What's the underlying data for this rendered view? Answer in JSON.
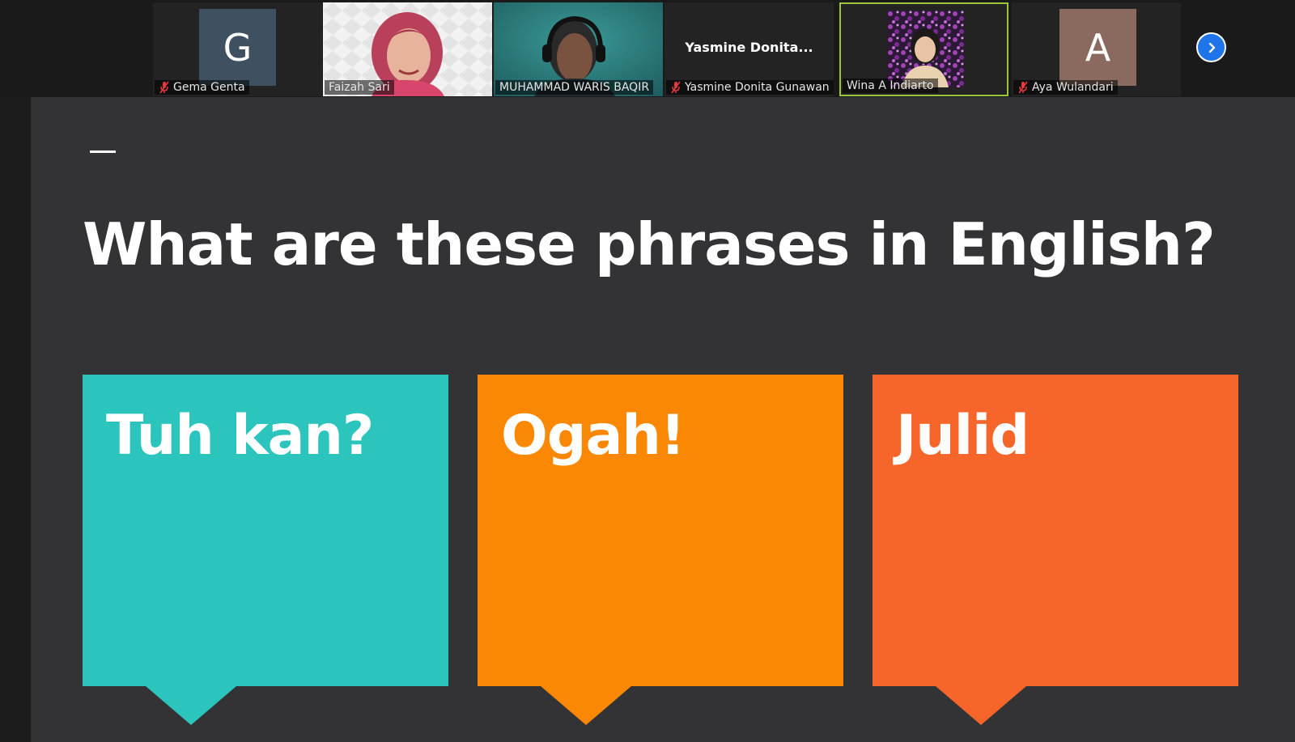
{
  "participants": [
    {
      "name": "Gema Genta",
      "initial": "G",
      "avatar_color": "#3f5160",
      "muted": true,
      "video": false
    },
    {
      "name": "Faizah Sari",
      "muted": false,
      "video": true
    },
    {
      "name": "MUHAMMAD WARIS BAQIR",
      "muted": false,
      "video": true
    },
    {
      "name": "Yasmine Donita Gunawan",
      "short_name": "Yasmine  Donita...",
      "muted": true,
      "video": false
    },
    {
      "name": "Wina A Indiarto",
      "muted": false,
      "video": true,
      "active_speaker": true
    },
    {
      "name": "Aya Wulandari",
      "initial": "A",
      "avatar_color": "#8a6a5e",
      "muted": true,
      "video": false
    }
  ],
  "next_page_icon": "chevron-right-icon",
  "slide": {
    "title": "What are these phrases in English?",
    "cards": [
      {
        "label": "Tuh kan?",
        "color": "#2cc5bd"
      },
      {
        "label": "Ogah!",
        "color": "#fb8805"
      },
      {
        "label": "Julid",
        "color": "#f6662a"
      }
    ]
  }
}
